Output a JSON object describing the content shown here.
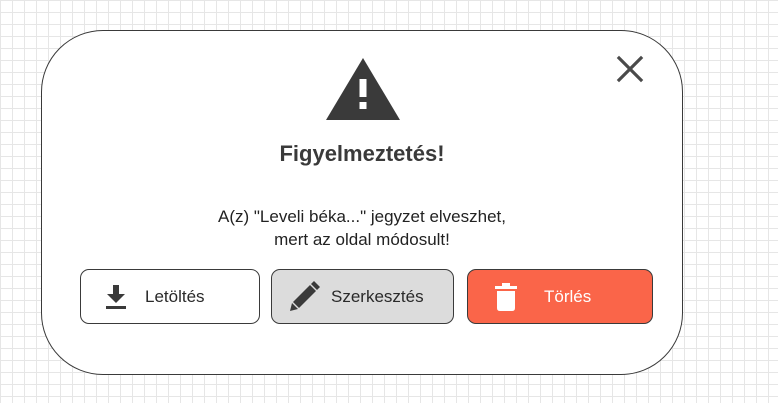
{
  "dialog": {
    "title": "Figyelmeztetés!",
    "message_line1": "A(z) \"Leveli béka...\" jegyzet elveszhet,",
    "message_line2": "mert az oldal módosult!",
    "close_icon": "close-icon",
    "warning_icon": "warning-triangle-icon"
  },
  "buttons": {
    "download": {
      "label": "Letöltés",
      "icon": "download-icon"
    },
    "edit": {
      "label": "Szerkesztés",
      "icon": "pencil-icon"
    },
    "delete": {
      "label": "Törlés",
      "icon": "trash-icon",
      "color": "#fa6549"
    }
  },
  "colors": {
    "text": "#3a3a3a",
    "edit_bg": "#dcdcdc",
    "delete_bg": "#fa6549"
  }
}
